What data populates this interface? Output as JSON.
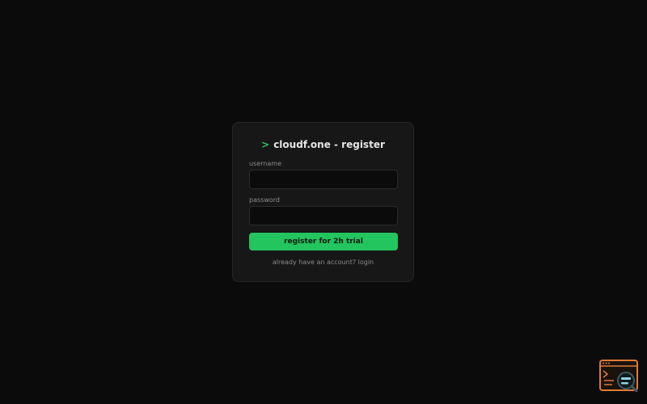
{
  "form": {
    "title_prompt": ">",
    "title": "cloudf.one - register",
    "username_label": "username",
    "username_value": "",
    "password_label": "password",
    "password_value": "",
    "submit_label": "register for 2h trial",
    "login_link": "already have an account? login"
  },
  "widget": {
    "icon": "terminal-search-icon"
  },
  "colors": {
    "background": "#0b0b0b",
    "card": "#171717",
    "accent": "#22c55e",
    "widget": "#e07b39"
  }
}
